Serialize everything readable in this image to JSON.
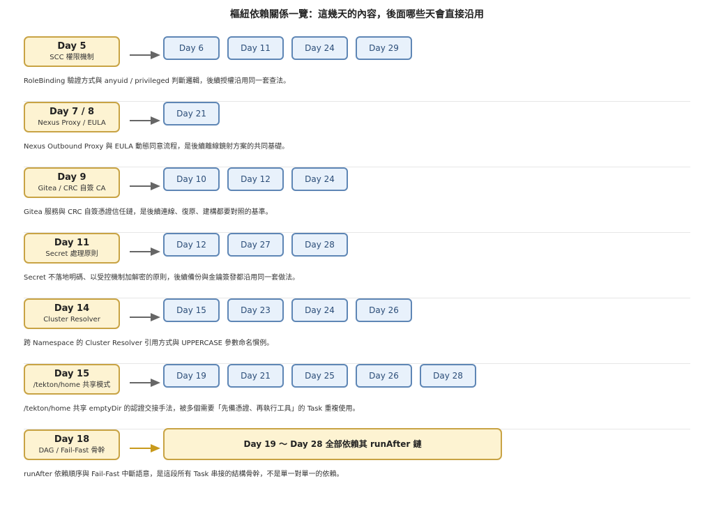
{
  "title": "樞紐依賴關係一覽：這幾天的內容，後面哪些天會直接沿用",
  "groups": [
    {
      "source": "Day 5",
      "subtitle": "SCC 權限機制",
      "targets": [
        "Day 6",
        "Day 11",
        "Day 24",
        "Day 29"
      ],
      "description": "RoleBinding 驗證方式與 anyuid / privileged 判斷邏輯，後續授權沿用同一套查法。"
    },
    {
      "source": "Day 7 / 8",
      "subtitle": "Nexus Proxy / EULA",
      "targets": [
        "Day 21"
      ],
      "description": "Nexus Outbound Proxy 與 EULA 動態同意流程，是後續離線鏡射方案的共同基礎。"
    },
    {
      "source": "Day 9",
      "subtitle": "Gitea / CRC 自簽 CA",
      "targets": [
        "Day 10",
        "Day 12",
        "Day 24"
      ],
      "description": "Gitea 服務與 CRC 自簽憑證信任鏈，是後續連線、復原、建構都要對照的基準。"
    },
    {
      "source": "Day 11",
      "subtitle": "Secret 處理原則",
      "targets": [
        "Day 12",
        "Day 27",
        "Day 28"
      ],
      "description": "Secret 不落地明碼、以受控機制加解密的原則，後續備份與金鑰簽發都沿用同一套做法。"
    },
    {
      "source": "Day 14",
      "subtitle": "Cluster Resolver",
      "targets": [
        "Day 15",
        "Day 23",
        "Day 24",
        "Day 26"
      ],
      "description": "跨 Namespace 的 Cluster Resolver 引用方式與 UPPERCASE 參數命名慣例。"
    },
    {
      "source": "Day 15",
      "subtitle": "/tekton/home 共享模式",
      "targets": [
        "Day 19",
        "Day 21",
        "Day 25",
        "Day 26",
        "Day 28"
      ],
      "description": "/tekton/home 共享 emptyDir 的認證交接手法，被多個需要「先備憑證、再執行工具」的 Task 重複使用。"
    },
    {
      "source": "Day 18",
      "subtitle": "DAG / Fail-Fast 骨幹",
      "combined": "Day 19 ～ Day 28 全部依賴其 runAfter 鏈",
      "description": "runAfter 依賴順序與 Fail-Fast 中斷語意，是這段所有 Task 串接的結構骨幹，不是單一對單一的依賴。"
    }
  ],
  "colors": {
    "source_fill": "#fdf3d2",
    "source_border": "#c8a344",
    "target_fill": "#e8f1fb",
    "target_border": "#5e86b5",
    "arrow": "#666666",
    "accent_arrow": "#c89a1c"
  }
}
